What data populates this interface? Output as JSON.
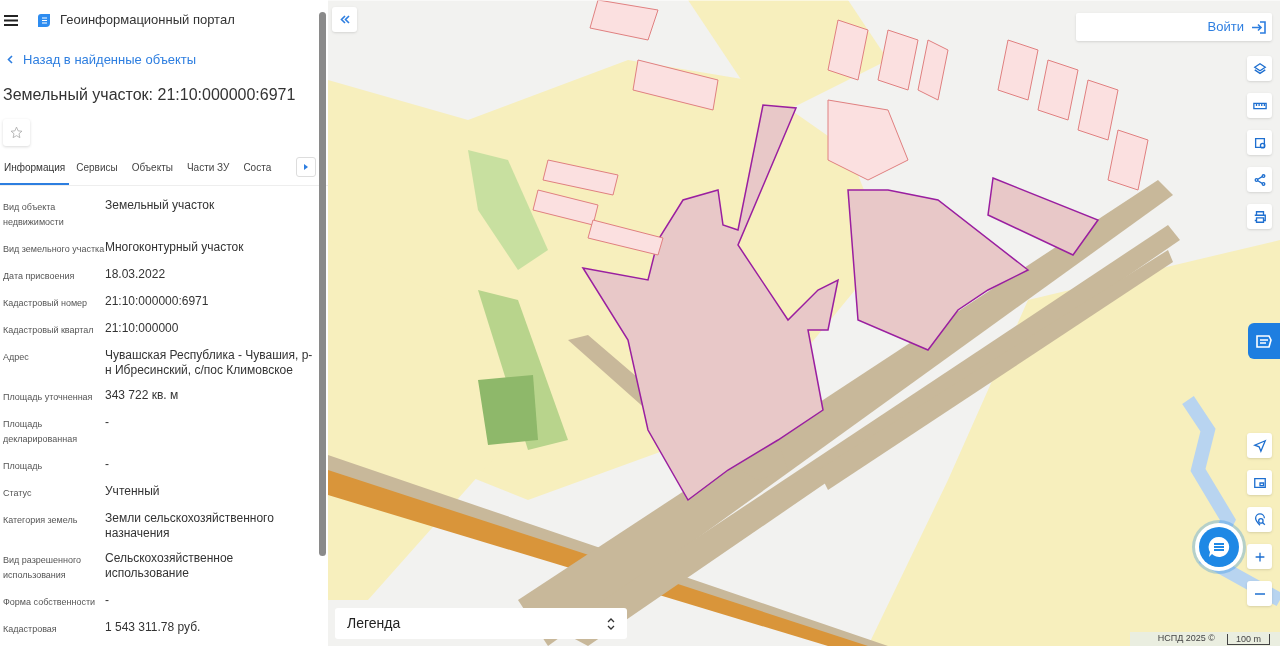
{
  "header": {
    "title": "Геоинформационный портал"
  },
  "back_link": "Назад в найденные объекты",
  "object_title": "Земельный участок: 21:10:000000:6971",
  "favorite": {
    "checked": false
  },
  "tabs": [
    {
      "label": "Информация",
      "selected": true
    },
    {
      "label": "Сервисы",
      "selected": false
    },
    {
      "label": "Объекты",
      "selected": false
    },
    {
      "label": "Части ЗУ",
      "selected": false
    },
    {
      "label": "Соста",
      "selected": false
    }
  ],
  "properties": [
    {
      "label": "Вид объекта недвижимости",
      "value": "Земельный участок"
    },
    {
      "label": "Вид земельного участка",
      "value": "Многоконтурный участок"
    },
    {
      "label": "Дата присвоения",
      "value": "18.03.2022"
    },
    {
      "label": "Кадастровый номер",
      "value": "21:10:000000:6971"
    },
    {
      "label": "Кадастровый квартал",
      "value": "21:10:000000"
    },
    {
      "label": "Адрес",
      "value": "Чувашская Республика - Чувашия, р-н Ибресинский, с/пос Климовское"
    },
    {
      "label": "Площадь уточненная",
      "value": "343 722 кв. м"
    },
    {
      "label": "Площадь декларированная",
      "value": "-"
    },
    {
      "label": "Площадь",
      "value": "-"
    },
    {
      "label": "Статус",
      "value": "Учтенный"
    },
    {
      "label": "Категория земель",
      "value": "Земли сельскохозяйственного назначения"
    },
    {
      "label": "Вид разрешенного использования",
      "value": "Сельскохозяйственное использование"
    },
    {
      "label": "Форма собственности",
      "value": "-"
    },
    {
      "label": "Кадастровая",
      "value": "1 543 311.78 руб."
    }
  ],
  "map": {
    "login_button": "Войти",
    "legend": {
      "label": "Легенда"
    },
    "attribution": "НСПД 2025 ©",
    "scale": "100 m"
  }
}
